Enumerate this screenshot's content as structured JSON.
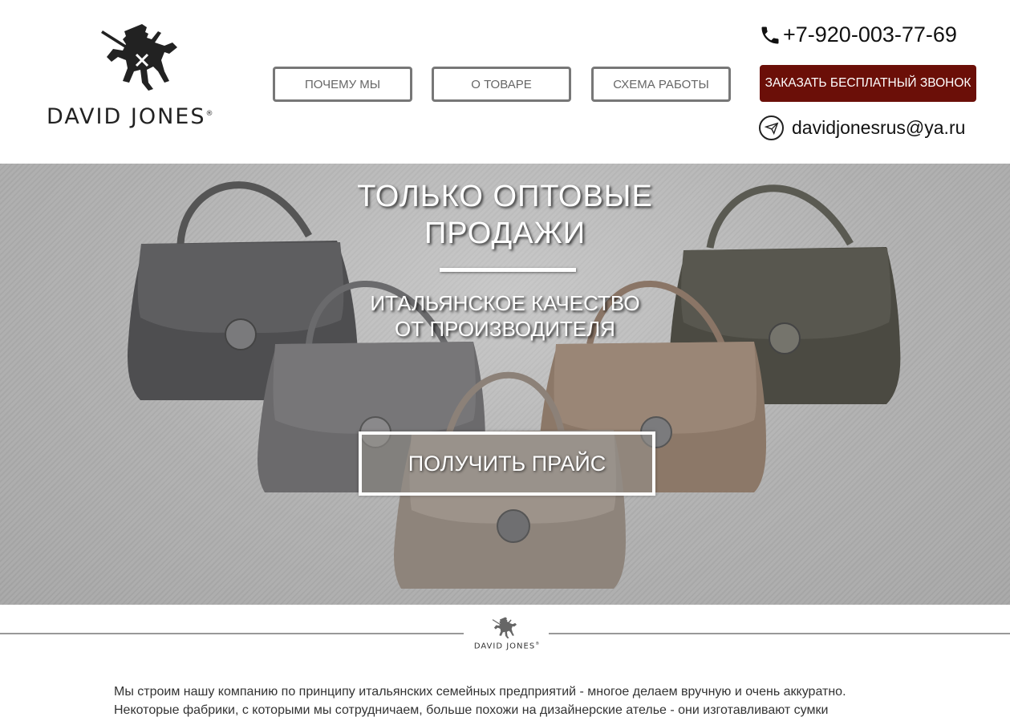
{
  "brand": {
    "name": "DAVID JONES",
    "registered_mark": "®"
  },
  "nav": {
    "items": [
      {
        "label": "ПОЧЕМУ МЫ"
      },
      {
        "label": "О ТОВАРЕ"
      },
      {
        "label": "СХЕМА РАБОТЫ"
      }
    ]
  },
  "contacts": {
    "phone": "+7-920-003-77-69",
    "call_button": "ЗАКАЗАТЬ БЕСПЛАТНЫЙ ЗВОНОК",
    "email": "davidjonesrus@ya.ru",
    "phone_icon": "phone-icon",
    "email_icon": "mail-icon"
  },
  "hero": {
    "title_line1": "ТОЛЬКО ОПТОВЫЕ",
    "title_line2": "ПРОДАЖИ",
    "subtitle_line1": "ИТАЛЬЯНСКОЕ КАЧЕСТВО",
    "subtitle_line2": "ОТ ПРОИЗВОДИТЕЛЯ",
    "cta": "ПОЛУЧИТЬ ПРАЙС"
  },
  "about": {
    "line1": "Мы строим нашу компанию по принципу итальянских семейных предприятий - многое делаем вручную и очень аккуратно.",
    "line2": "Некоторые фабрики, с которыми мы сотрудничаем, больше похожи на дизайнерские ателье - они изготавливают сумки"
  },
  "colors": {
    "accent": "#6b0f08",
    "nav_border": "#777777"
  }
}
